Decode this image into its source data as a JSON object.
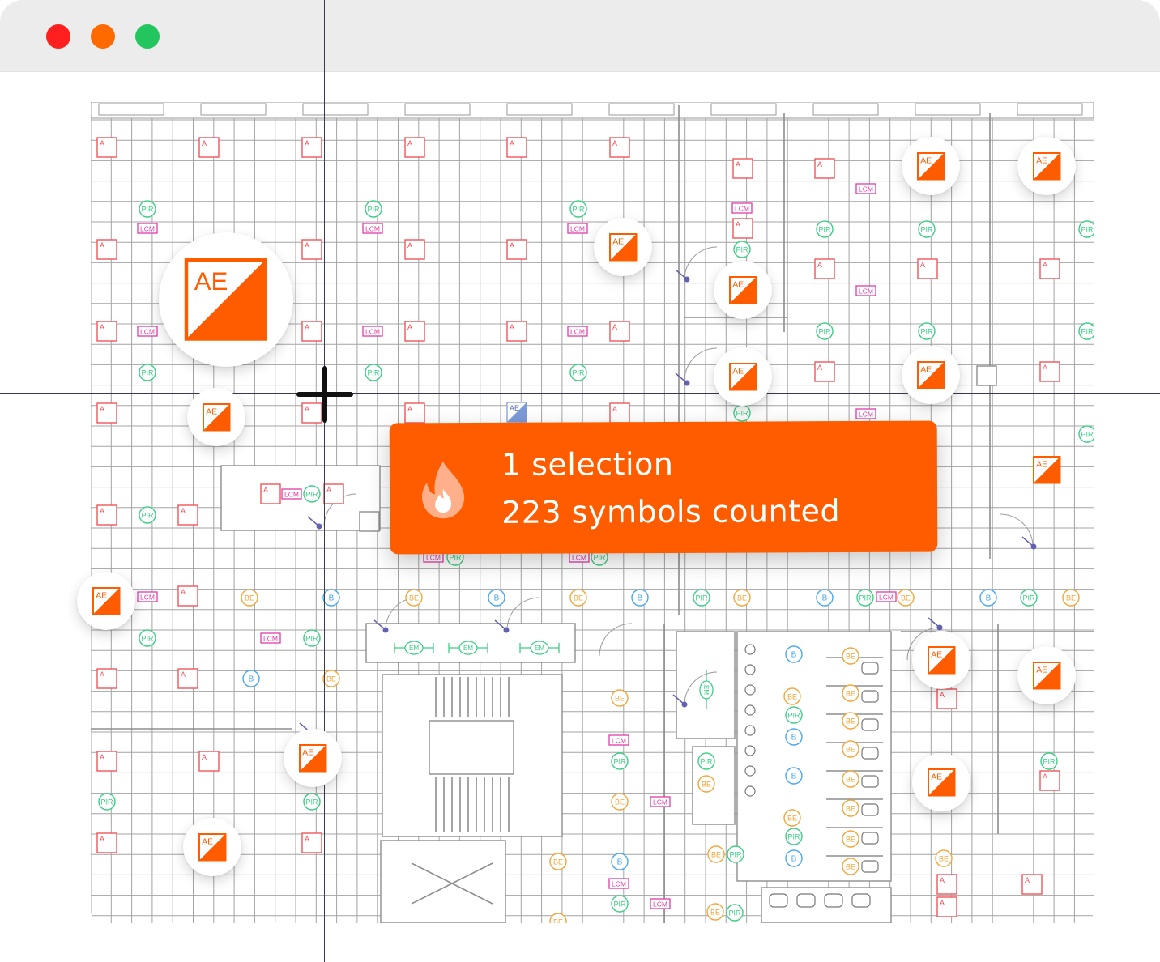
{
  "window": {
    "controls": [
      {
        "name": "close",
        "color": "#ff1f1f"
      },
      {
        "name": "minimize",
        "color": "#ff6a00"
      },
      {
        "name": "maximize",
        "color": "#22c55e"
      }
    ]
  },
  "plan": {
    "title": "",
    "symbol_labels": {
      "exit": "A",
      "pir": "PIR",
      "lcm": "LCM",
      "be": "BE",
      "b": "B",
      "em": "EM",
      "ae": "AE"
    },
    "colors": {
      "grid": "#a4a4a4",
      "exit": "#f0555a",
      "pir": "#3ccf85",
      "lcm": "#df3ca8",
      "be": "#f3a63a",
      "b": "#4aa8f0",
      "door": "#6462b0",
      "ae_accent": "#ff5c00"
    }
  },
  "marker": {
    "label": "AE",
    "icon": "ae-emergency-light-icon"
  },
  "toast": {
    "icon": "flame-icon",
    "line1": "1 selection",
    "line2": "223 symbols counted",
    "background": "#ff5c00"
  }
}
